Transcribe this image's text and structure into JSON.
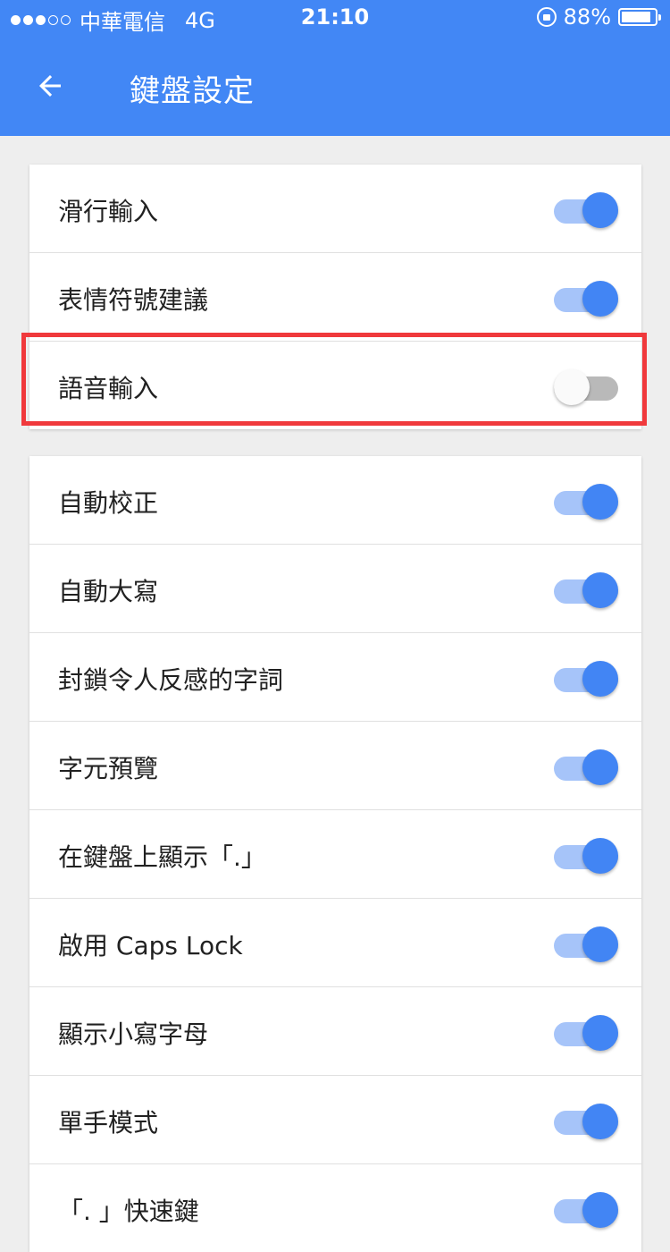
{
  "status_bar": {
    "carrier": "中華電信",
    "network": "4G",
    "time": "21:10",
    "battery_text": "88%",
    "battery_level": 0.88,
    "signal_bars": 3,
    "signal_total": 5
  },
  "app_bar": {
    "title": "鍵盤設定",
    "back_icon": "arrow-left-icon"
  },
  "colors": {
    "accent": "#4287f5",
    "switch_on": "#4285f4",
    "highlight": "#f0393c"
  },
  "card1": {
    "items": [
      {
        "label": "滑行輸入",
        "on": true
      },
      {
        "label": "表情符號建議",
        "on": true
      },
      {
        "label": "語音輸入",
        "on": false
      }
    ]
  },
  "card2": {
    "items": [
      {
        "label": "自動校正",
        "on": true
      },
      {
        "label": "自動大寫",
        "on": true
      },
      {
        "label": "封鎖令人反感的字詞",
        "on": true
      },
      {
        "label": "字元預覽",
        "on": true
      },
      {
        "label": "在鍵盤上顯示「.」",
        "on": true
      },
      {
        "label": "啟用 Caps Lock",
        "on": true
      },
      {
        "label": "顯示小寫字母",
        "on": true
      },
      {
        "label": "單手模式",
        "on": true
      },
      {
        "label": "「. 」快速鍵",
        "on": true
      }
    ]
  }
}
